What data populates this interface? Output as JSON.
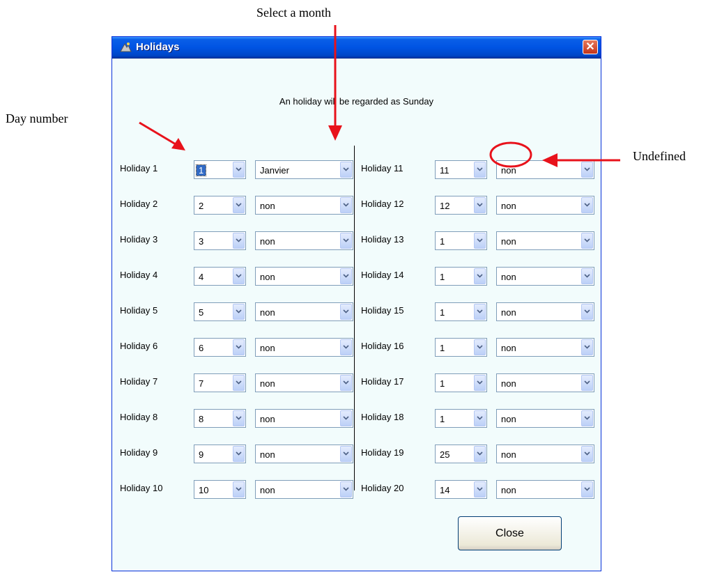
{
  "annotations": {
    "select_month": "Select a month",
    "day_number": "Day number",
    "undefined": "Undefined"
  },
  "window": {
    "title": "Holidays",
    "close_glyph": "✕",
    "subtitle": "An holiday will be regarded as Sunday",
    "close_button": "Close"
  },
  "colors": {
    "annotation_red": "#e8121b",
    "titlebar_blue": "#0054e3",
    "client_bg": "#f2fcfc",
    "selection_blue": "#316ac5"
  },
  "holidays_left": [
    {
      "label": "Holiday 1",
      "day": "1",
      "month": "Janvier"
    },
    {
      "label": "Holiday 2",
      "day": "2",
      "month": "non"
    },
    {
      "label": "Holiday 3",
      "day": "3",
      "month": "non"
    },
    {
      "label": "Holiday 4",
      "day": "4",
      "month": "non"
    },
    {
      "label": "Holiday 5",
      "day": "5",
      "month": "non"
    },
    {
      "label": "Holiday 6",
      "day": "6",
      "month": "non"
    },
    {
      "label": "Holiday 7",
      "day": "7",
      "month": "non"
    },
    {
      "label": "Holiday 8",
      "day": "8",
      "month": "non"
    },
    {
      "label": "Holiday 9",
      "day": "9",
      "month": "non"
    },
    {
      "label": "Holiday 10",
      "day": "10",
      "month": "non"
    }
  ],
  "holidays_right": [
    {
      "label": "Holiday 11",
      "day": "11",
      "month": "non"
    },
    {
      "label": "Holiday 12",
      "day": "12",
      "month": "non"
    },
    {
      "label": "Holiday 13",
      "day": "1",
      "month": "non"
    },
    {
      "label": "Holiday 14",
      "day": "1",
      "month": "non"
    },
    {
      "label": "Holiday 15",
      "day": "1",
      "month": "non"
    },
    {
      "label": "Holiday 16",
      "day": "1",
      "month": "non"
    },
    {
      "label": "Holiday 17",
      "day": "1",
      "month": "non"
    },
    {
      "label": "Holiday 18",
      "day": "1",
      "month": "non"
    },
    {
      "label": "Holiday 19",
      "day": "25",
      "month": "non"
    },
    {
      "label": "Holiday 20",
      "day": "14",
      "month": "non"
    }
  ]
}
